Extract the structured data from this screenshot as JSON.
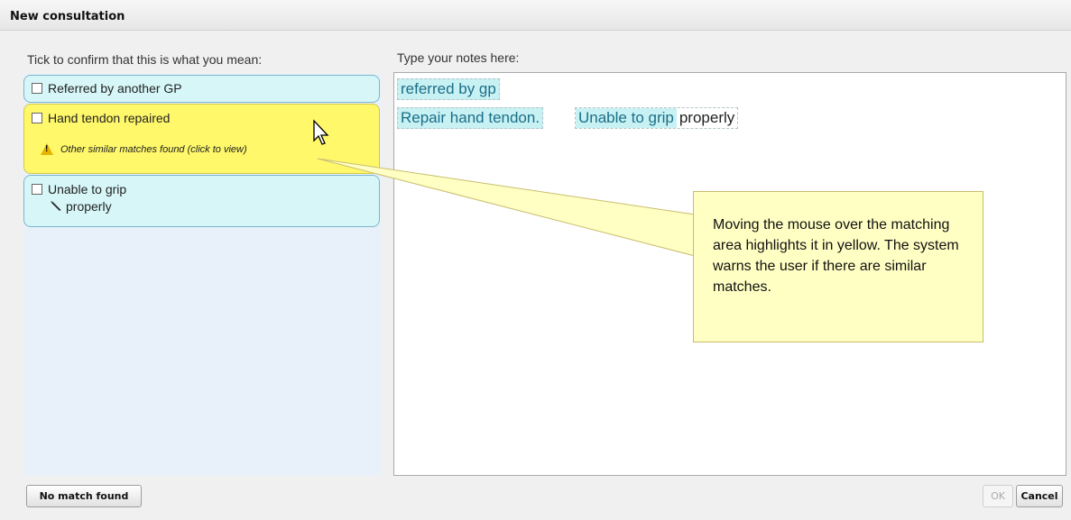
{
  "window": {
    "title": "New consultation"
  },
  "left": {
    "label": "Tick to confirm that this is what you mean:",
    "matches": [
      {
        "label": "Referred by another GP",
        "checked": false
      },
      {
        "label": "Hand tendon repaired",
        "checked": false,
        "warning": "Other similar matches found (click to view)",
        "hovered": true
      },
      {
        "label": "Unable to grip",
        "checked": false,
        "sub": "properly"
      }
    ]
  },
  "notes": {
    "label": "Type your notes here:",
    "chunks": [
      {
        "text": "referred by gp",
        "highlighted": true
      },
      {
        "text": "Repair hand tendon.",
        "highlighted": true
      },
      {
        "text": "Unable to grip",
        "highlighted": true
      },
      {
        "text": "properly",
        "highlighted": false
      }
    ]
  },
  "callout": {
    "text": "Moving the mouse over the matching area highlights it in yellow. The system warns the user if there are similar matches."
  },
  "buttons": {
    "no_match": "No match found",
    "ok": "OK",
    "cancel": "Cancel"
  },
  "colors": {
    "match_bg": "#d6f6f8",
    "hover_bg": "#fff86a",
    "callout_bg": "#ffffc4",
    "highlight_text": "#1c6e88"
  }
}
